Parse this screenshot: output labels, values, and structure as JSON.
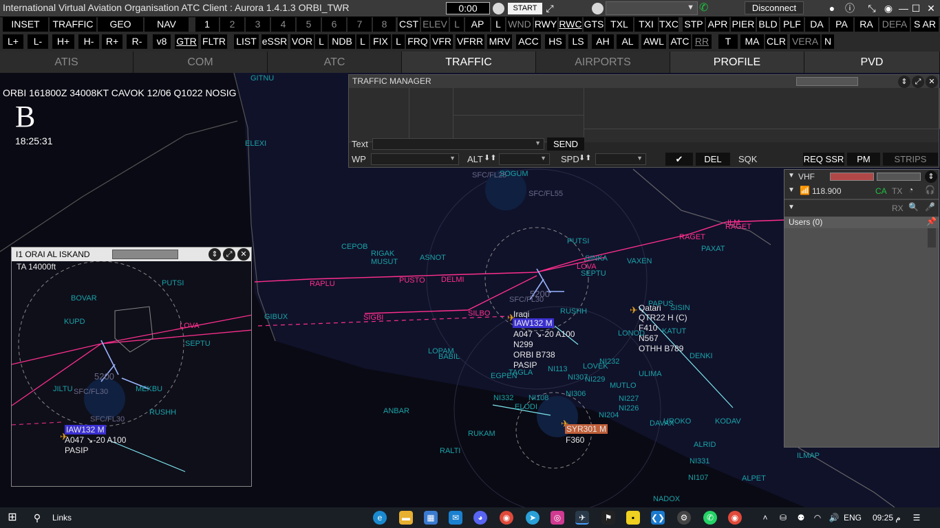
{
  "window": {
    "title": "International Virtual Aviation Organisation  ATC Client : Aurora 1.4.1.3   ORBI_TWR",
    "timer": "0:00",
    "start_label": "START",
    "disconnect_label": "Disconnect"
  },
  "toolbar1": [
    "INSET",
    "TRAFFIC",
    "GEO",
    "NAV",
    "1",
    "2",
    "3",
    "4",
    "5",
    "6",
    "7",
    "8",
    "CST",
    "ELEV",
    "L",
    "AP",
    "L",
    "WND",
    "RWY",
    "RWC",
    "GTS",
    "TXL",
    "TXI",
    "TXC",
    "STP",
    "APR",
    "PIER",
    "BLD",
    "PLF",
    "DA",
    "PA",
    "RA",
    "DEFA",
    "S AR"
  ],
  "toolbar2": [
    "L+",
    "L-",
    "H+",
    "H-",
    "R+",
    "R-",
    "v8",
    "GTR",
    "FLTR",
    "LIST",
    "eSSR",
    "VOR",
    "L",
    "NDB",
    "L",
    "FIX",
    "L",
    "FRQ",
    "VFR",
    "VFRR",
    "MRV",
    "ACC",
    "HS",
    "LS",
    "AH",
    "AL",
    "AWL",
    "ATC",
    "RR",
    "T",
    "MA",
    "CLR",
    "VERA",
    "N"
  ],
  "tabs": [
    "ATIS",
    "COM",
    "ATC",
    "TRAFFIC",
    "AIRPORTS",
    "PROFILE",
    "PVD"
  ],
  "atis": {
    "metar": "ORBI 161800Z 34008KT CAVOK 12/06 Q1022 NOSIG",
    "letter": "B",
    "time": "18:25:31"
  },
  "traffic_manager": {
    "title": "TRAFFIC MANAGER",
    "text_label": "Text",
    "send_label": "SEND",
    "wp_label": "WP",
    "alt_label": "ALT",
    "spd_label": "SPD",
    "del_label": "DEL",
    "sqk_label": "SQK",
    "req_ssr_label": "REQ SSR",
    "pm_label": "PM",
    "strips_label": "STRIPS"
  },
  "inset": {
    "title": "I1  ORAI AL ISKAND",
    "ta": "TA 14000ft"
  },
  "vhf": {
    "title": "VHF",
    "freq": "118.900",
    "ca": "CA",
    "tx": "TX",
    "rx": "RX",
    "users": "Users (0)"
  },
  "map": {
    "fixes_cyan": [
      "GITNU",
      "ELEXI",
      "SOGUM",
      "PUTSI",
      "SINKA",
      "VAXEN",
      "PAXAT",
      "SEPTU",
      "RIGAK",
      "MUSUT",
      "ASNOT",
      "CEPOB",
      "GIBUX",
      "RUSHH",
      "PAPUS",
      "SISIN",
      "KATUT",
      "DENKI",
      "ULIMA",
      "LOPAM",
      "BABIL",
      "EGPEN",
      "TAGLA",
      "ANBAR",
      "RUKAM",
      "RALTI",
      "KODAV",
      "ALRID",
      "ILMAP",
      "ALPET",
      "NADOX",
      "NI331",
      "NI107",
      "NI332",
      "NI108",
      "NI226",
      "NI227",
      "NI229",
      "NI232",
      "NI113",
      "NI307",
      "NI306",
      "NI204",
      "LOVEK",
      "MUTLO",
      "LONOD",
      "DAVAX",
      "UROKO",
      "ELODI"
    ],
    "fixes_pink": [
      "RAPLU",
      "PUSTO",
      "DELMI",
      "SIGBI",
      "SILBO",
      "RAGET",
      "ILM",
      "RAGET",
      "LOVA"
    ],
    "airspace": [
      "SFC/FL25",
      "SFC/FL55",
      "SFC/FL30",
      "5200"
    ],
    "aircraft_main": {
      "callsign": "IAW132 M",
      "operator": "Iraqi",
      "line2": "A047 ↘-20 A100",
      "line3": "N299",
      "line4": "ORBI B738",
      "line5": "PASIP"
    },
    "aircraft_qatar": {
      "operator": "Qatari",
      "callsign": "QTR22 H (C)",
      "line2": "F410",
      "line3": "N567",
      "line4": "OTHH B789"
    },
    "aircraft_syr": {
      "callsign": "SYR301 M",
      "line2": "F360"
    },
    "inset_aircraft": {
      "callsign": "IAW132 M",
      "line2": "A047 ↘-20 A100",
      "line3": "PASIP"
    }
  },
  "taskbar": {
    "search": "Links",
    "lang": "ENG",
    "time": "09:25 م"
  },
  "colors": {
    "route": "#ff2f8e",
    "fix": "#1aa3a8",
    "callsign_bg": "#3a2fd0",
    "syr_bg": "#c0603a",
    "aircraft": "#e6a020"
  }
}
